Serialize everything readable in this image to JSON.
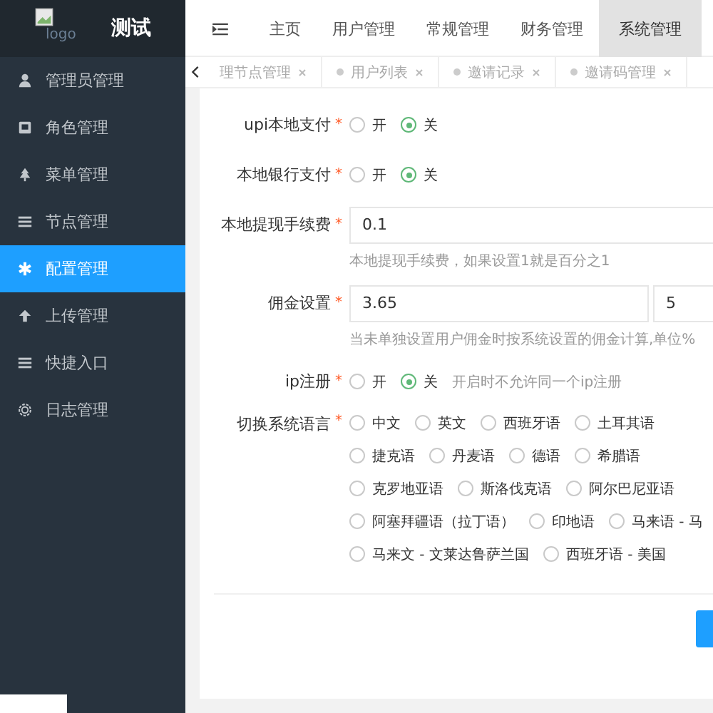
{
  "logo": {
    "alt": "logo",
    "title": "测试"
  },
  "sidebar": {
    "items": [
      {
        "label": "管理员管理",
        "selected": false
      },
      {
        "label": "角色管理",
        "selected": false
      },
      {
        "label": "菜单管理",
        "selected": false
      },
      {
        "label": "节点管理",
        "selected": false
      },
      {
        "label": "配置管理",
        "selected": true
      },
      {
        "label": "上传管理",
        "selected": false
      },
      {
        "label": "快捷入口",
        "selected": false
      },
      {
        "label": "日志管理",
        "selected": false
      }
    ]
  },
  "nav": {
    "items": [
      {
        "label": "主页",
        "selected": false
      },
      {
        "label": "用户管理",
        "selected": false
      },
      {
        "label": "常规管理",
        "selected": false
      },
      {
        "label": "财务管理",
        "selected": false
      },
      {
        "label": "系统管理",
        "selected": true
      }
    ]
  },
  "tabs": [
    {
      "label": "理节点管理",
      "dot": false
    },
    {
      "label": "用户列表",
      "dot": true
    },
    {
      "label": "邀请记录",
      "dot": true
    },
    {
      "label": "邀请码管理",
      "dot": true
    }
  ],
  "form": {
    "rows": [
      {
        "kind": "radio",
        "label": "upi本地支付",
        "mark": "*",
        "options": [
          {
            "label": "开",
            "selected": false
          },
          {
            "label": "关",
            "selected": true
          }
        ]
      },
      {
        "kind": "radio",
        "label": "本地银行支付",
        "mark": "*",
        "options": [
          {
            "label": "开",
            "selected": false
          },
          {
            "label": "关",
            "selected": true
          }
        ]
      },
      {
        "kind": "input",
        "label": "本地提现手续费",
        "mark": "*",
        "values": [
          "0.1"
        ],
        "help": "本地提现手续费，如果设置1就是百分之1"
      },
      {
        "kind": "input",
        "label": "佣金设置",
        "mark": "*",
        "values": [
          "3.65",
          "5"
        ],
        "help": "当未单独设置用户佣金时按系统设置的佣金计算,单位%"
      },
      {
        "kind": "radio",
        "label": "ip注册",
        "mark": "*",
        "options": [
          {
            "label": "开",
            "selected": false
          },
          {
            "label": "关",
            "selected": true
          }
        ],
        "hint": "开启时不允许同一个ip注册"
      },
      {
        "kind": "radiolines",
        "label": "切换系统语言",
        "mark": "*",
        "lines": [
          [
            {
              "label": "中文",
              "selected": false
            },
            {
              "label": "英文",
              "selected": false
            },
            {
              "label": "西班牙语",
              "selected": false
            },
            {
              "label": "土耳其语",
              "selected": false
            }
          ],
          [
            {
              "label": "捷克语",
              "selected": false
            },
            {
              "label": "丹麦语",
              "selected": false
            },
            {
              "label": "德语",
              "selected": false
            },
            {
              "label": "希腊语",
              "selected": false
            }
          ],
          [
            {
              "label": "克罗地亚语",
              "selected": false
            },
            {
              "label": "斯洛伐克语",
              "selected": false
            },
            {
              "label": "阿尔巴尼亚语",
              "selected": false
            }
          ],
          [
            {
              "label": "阿塞拜疆语（拉丁语）",
              "selected": false
            },
            {
              "label": "印地语",
              "selected": false
            },
            {
              "label": "马来语 - 马",
              "selected": false
            }
          ],
          [
            {
              "label": "马来文 - 文莱达鲁萨兰国",
              "selected": false
            },
            {
              "label": "西班牙语 - 美国",
              "selected": false
            }
          ]
        ]
      }
    ]
  }
}
